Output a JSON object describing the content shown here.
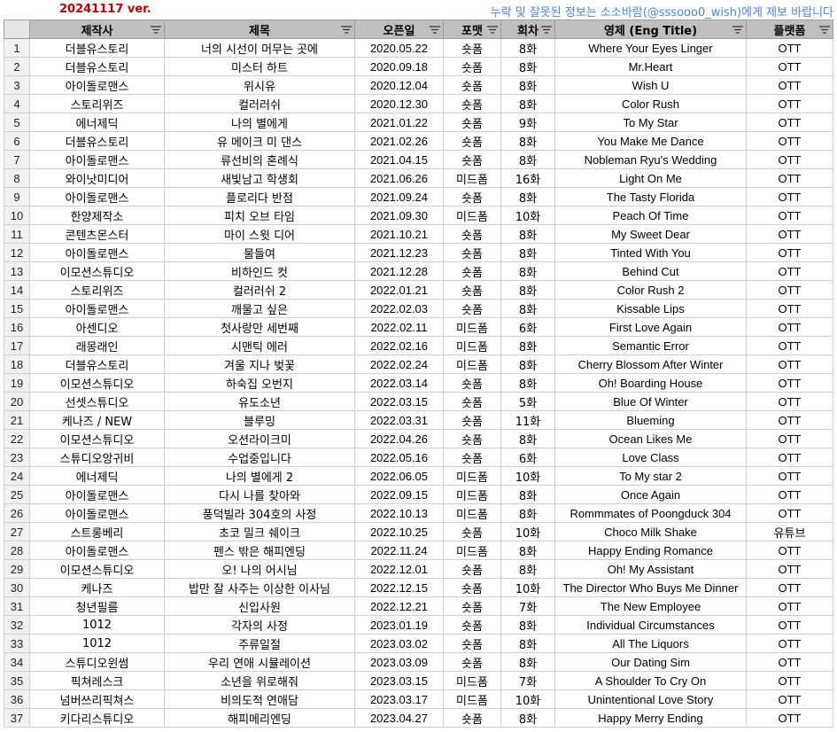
{
  "header": {
    "version": "20241117 ver.",
    "notice": "누락 및 잘못된 정보는 소소바람(@sssooo0_wish)에게 제보 바랍니다"
  },
  "columns": [
    "제작사",
    "제목",
    "오픈일",
    "포맷",
    "회차",
    "영제 (Eng Title)",
    "플랫폼"
  ],
  "rows": [
    {
      "n": "1",
      "studio": "더블유스토리",
      "title": "너의 시선이 머무는 곳에",
      "date": "2020.05.22",
      "format": "숏폼",
      "eps": "8화",
      "eng": "Where Your Eyes Linger",
      "platform": "OTT"
    },
    {
      "n": "2",
      "studio": "더블유스토리",
      "title": "미스터 하트",
      "date": "2020.09.18",
      "format": "숏폼",
      "eps": "8화",
      "eng": "Mr.Heart",
      "platform": "OTT"
    },
    {
      "n": "3",
      "studio": "아이돌로맨스",
      "title": "위시유",
      "date": "2020.12.04",
      "format": "숏폼",
      "eps": "8화",
      "eng": "Wish U",
      "platform": "OTT"
    },
    {
      "n": "4",
      "studio": "스토리위즈",
      "title": "컬러러쉬",
      "date": "2020.12.30",
      "format": "숏폼",
      "eps": "8화",
      "eng": "Color Rush",
      "platform": "OTT"
    },
    {
      "n": "5",
      "studio": "에너제딕",
      "title": "나의 별에게",
      "date": "2021.01.22",
      "format": "숏폼",
      "eps": "9화",
      "eng": "To My Star",
      "platform": "OTT"
    },
    {
      "n": "6",
      "studio": "더블유스토리",
      "title": "유 메이크 미 댄스",
      "date": "2021.02.26",
      "format": "숏폼",
      "eps": "8화",
      "eng": "You Make Me Dance",
      "platform": "OTT"
    },
    {
      "n": "7",
      "studio": "아이돌로맨스",
      "title": "류선비의 혼례식",
      "date": "2021.04.15",
      "format": "숏폼",
      "eps": "8화",
      "eng": "Nobleman Ryu's Wedding",
      "platform": "OTT"
    },
    {
      "n": "8",
      "studio": "와이낫미디어",
      "title": "새빛남고 학생회",
      "date": "2021.06.26",
      "format": "미드폼",
      "eps": "16화",
      "eng": "Light On Me",
      "platform": "OTT"
    },
    {
      "n": "9",
      "studio": "아이돌로맨스",
      "title": "플로리다 반점",
      "date": "2021.09.24",
      "format": "숏폼",
      "eps": "8화",
      "eng": "The Tasty Florida",
      "platform": "OTT"
    },
    {
      "n": "10",
      "studio": "한양제작소",
      "title": "피치 오브 타임",
      "date": "2021.09.30",
      "format": "미드폼",
      "eps": "10화",
      "eng": "Peach Of Time",
      "platform": "OTT"
    },
    {
      "n": "11",
      "studio": "콘텐츠몬스터",
      "title": "마이 스윗 디어",
      "date": "2021.10.21",
      "format": "숏폼",
      "eps": "8화",
      "eng": "My Sweet Dear",
      "platform": "OTT"
    },
    {
      "n": "12",
      "studio": "아이돌로맨스",
      "title": "물들여",
      "date": "2021.12.23",
      "format": "숏폼",
      "eps": "8화",
      "eng": "Tinted With You",
      "platform": "OTT"
    },
    {
      "n": "13",
      "studio": "이모션스튜디오",
      "title": "비하인드 컷",
      "date": "2021.12.28",
      "format": "숏폼",
      "eps": "8화",
      "eng": "Behind Cut",
      "platform": "OTT"
    },
    {
      "n": "14",
      "studio": "스토리위즈",
      "title": "컬러러쉬 2",
      "date": "2022.01.21",
      "format": "숏폼",
      "eps": "8화",
      "eng": "Color Rush 2",
      "platform": "OTT"
    },
    {
      "n": "15",
      "studio": "아이돌로맨스",
      "title": "깨물고 싶은",
      "date": "2022.02.03",
      "format": "숏폼",
      "eps": "8화",
      "eng": "Kissable Lips",
      "platform": "OTT"
    },
    {
      "n": "16",
      "studio": "아센디오",
      "title": "첫사랑만 세번째",
      "date": "2022.02.11",
      "format": "미드폼",
      "eps": "6화",
      "eng": "First Love Again",
      "platform": "OTT"
    },
    {
      "n": "17",
      "studio": "래몽래인",
      "title": "시맨틱 에러",
      "date": "2022.02.16",
      "format": "미드폼",
      "eps": "8화",
      "eng": "Semantic Error",
      "platform": "OTT"
    },
    {
      "n": "18",
      "studio": "더블유스토리",
      "title": "겨울 지나 벚꽃",
      "date": "2022.02.24",
      "format": "미드폼",
      "eps": "8화",
      "eng": "Cherry Blossom After Winter",
      "platform": "OTT"
    },
    {
      "n": "19",
      "studio": "이모션스튜디오",
      "title": "하숙집 오번지",
      "date": "2022.03.14",
      "format": "숏폼",
      "eps": "8화",
      "eng": "Oh! Boarding House",
      "platform": "OTT"
    },
    {
      "n": "20",
      "studio": "선셋스튜디오",
      "title": "유도소년",
      "date": "2022.03.15",
      "format": "숏폼",
      "eps": "5화",
      "eng": "Blue Of Winter",
      "platform": "OTT"
    },
    {
      "n": "21",
      "studio": "케나즈 / NEW",
      "title": "블루밍",
      "date": "2022.03.31",
      "format": "숏폼",
      "eps": "11화",
      "eng": "Blueming",
      "platform": "OTT"
    },
    {
      "n": "22",
      "studio": "이모션스튜디오",
      "title": "오션라이크미",
      "date": "2022.04.26",
      "format": "숏폼",
      "eps": "8화",
      "eng": "Ocean Likes Me",
      "platform": "OTT"
    },
    {
      "n": "23",
      "studio": "스튜디오앙귀비",
      "title": "수업중입니다",
      "date": "2022.05.16",
      "format": "숏폼",
      "eps": "6화",
      "eng": "Love Class",
      "platform": "OTT"
    },
    {
      "n": "24",
      "studio": "에너제딕",
      "title": "나의 별에게 2",
      "date": "2022.06.05",
      "format": "미드폼",
      "eps": "10화",
      "eng": "To My star 2",
      "platform": "OTT"
    },
    {
      "n": "25",
      "studio": "아이돌로맨스",
      "title": "다시 나를 찾아와",
      "date": "2022.09.15",
      "format": "미드폼",
      "eps": "8화",
      "eng": "Once Again",
      "platform": "OTT"
    },
    {
      "n": "26",
      "studio": "아이돌로맨스",
      "title": "풍덕빌라 304호의 사정",
      "date": "2022.10.13",
      "format": "미드폼",
      "eps": "8화",
      "eng": "Rommmates of Poongduck 304",
      "platform": "OTT"
    },
    {
      "n": "27",
      "studio": "스트롱베리",
      "title": "초코 밀크 쉐이크",
      "date": "2022.10.25",
      "format": "숏폼",
      "eps": "10화",
      "eng": "Choco Milk Shake",
      "platform": "유튜브"
    },
    {
      "n": "28",
      "studio": "아이돌로맨스",
      "title": "펜스 밖은 해피엔딩",
      "date": "2022.11.24",
      "format": "미드폼",
      "eps": "8화",
      "eng": "Happy Ending Romance",
      "platform": "OTT"
    },
    {
      "n": "29",
      "studio": "이모션스튜디오",
      "title": "오! 나의 어시님",
      "date": "2022.12.01",
      "format": "숏폼",
      "eps": "8화",
      "eng": "Oh! My Assistant",
      "platform": "OTT"
    },
    {
      "n": "30",
      "studio": "케나즈",
      "title": "밥만 잘 사주는 이상한 이사님",
      "date": "2022.12.15",
      "format": "숏폼",
      "eps": "10화",
      "eng": "The Director Who Buys Me Dinner",
      "platform": "OTT"
    },
    {
      "n": "31",
      "studio": "청년필름",
      "title": "신입사원",
      "date": "2022.12.21",
      "format": "숏폼",
      "eps": "7화",
      "eng": "The New Employee",
      "platform": "OTT"
    },
    {
      "n": "32",
      "studio": "1012",
      "title": "각자의 사정",
      "date": "2023.01.19",
      "format": "숏폼",
      "eps": "8화",
      "eng": "Individual Circumstances",
      "platform": "OTT"
    },
    {
      "n": "33",
      "studio": "1012",
      "title": "주류일절",
      "date": "2023.03.02",
      "format": "숏폼",
      "eps": "8화",
      "eng": "All The Liquors",
      "platform": "OTT"
    },
    {
      "n": "34",
      "studio": "스튜디오윈썸",
      "title": "우리 연애 시뮬레이션",
      "date": "2023.03.09",
      "format": "숏폼",
      "eps": "8화",
      "eng": "Our Dating Sim",
      "platform": "OTT"
    },
    {
      "n": "35",
      "studio": "픽쳐레스크",
      "title": "소년을 위로해줘",
      "date": "2023.03.15",
      "format": "미드폼",
      "eps": "7화",
      "eng": "A Shoulder To Cry On",
      "platform": "OTT"
    },
    {
      "n": "36",
      "studio": "넘버쓰리픽쳐스",
      "title": "비의도적 연애담",
      "date": "2023.03.17",
      "format": "미드폼",
      "eps": "10화",
      "eng": "Unintentional Love Story",
      "platform": "OTT"
    },
    {
      "n": "37",
      "studio": "키다리스튜디오",
      "title": "해피메리엔딩",
      "date": "2023.04.27",
      "format": "숏폼",
      "eps": "8화",
      "eng": "Happy Merry Ending",
      "platform": "OTT"
    }
  ]
}
